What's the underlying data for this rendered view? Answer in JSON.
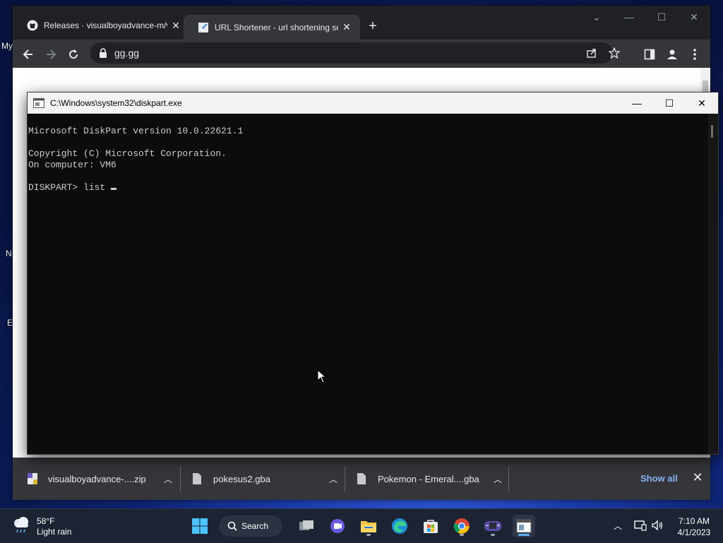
{
  "desktop": {
    "labels": [
      "My",
      "N",
      "E"
    ]
  },
  "browser": {
    "tabs": [
      {
        "title": "Releases · visualboyadvance-m/v",
        "icon": "github-icon",
        "active": false
      },
      {
        "title": "URL Shortener - url shortening se",
        "icon": "link-favicon-icon",
        "active": true
      }
    ],
    "new_tab_icon": "plus-icon",
    "url": "gg.gg",
    "downloads": [
      {
        "name": "visualboyadvance-....zip",
        "icon": "zip-file-icon"
      },
      {
        "name": "pokesus2.gba",
        "icon": "file-icon"
      },
      {
        "name": "Pokemon - Emeral....gba",
        "icon": "file-icon"
      }
    ],
    "show_all": "Show all"
  },
  "console": {
    "title": "C:\\Windows\\system32\\diskpart.exe",
    "lines": [
      "Microsoft DiskPart version 10.0.22621.1",
      "",
      "Copyright (C) Microsoft Corporation.",
      "On computer: VM6",
      "",
      "DISKPART> list "
    ]
  },
  "taskbar": {
    "weather": {
      "temp": "58°F",
      "condition": "Light rain"
    },
    "search_label": "Search",
    "time": "7:10 AM",
    "date": "4/1/2023"
  },
  "colors": {
    "chrome_dark": "#35363a",
    "console_bg": "#0c0c0c",
    "console_text": "#cccccc",
    "link_blue": "#8ab4f8",
    "taskbar_bg": "#1c2433"
  }
}
